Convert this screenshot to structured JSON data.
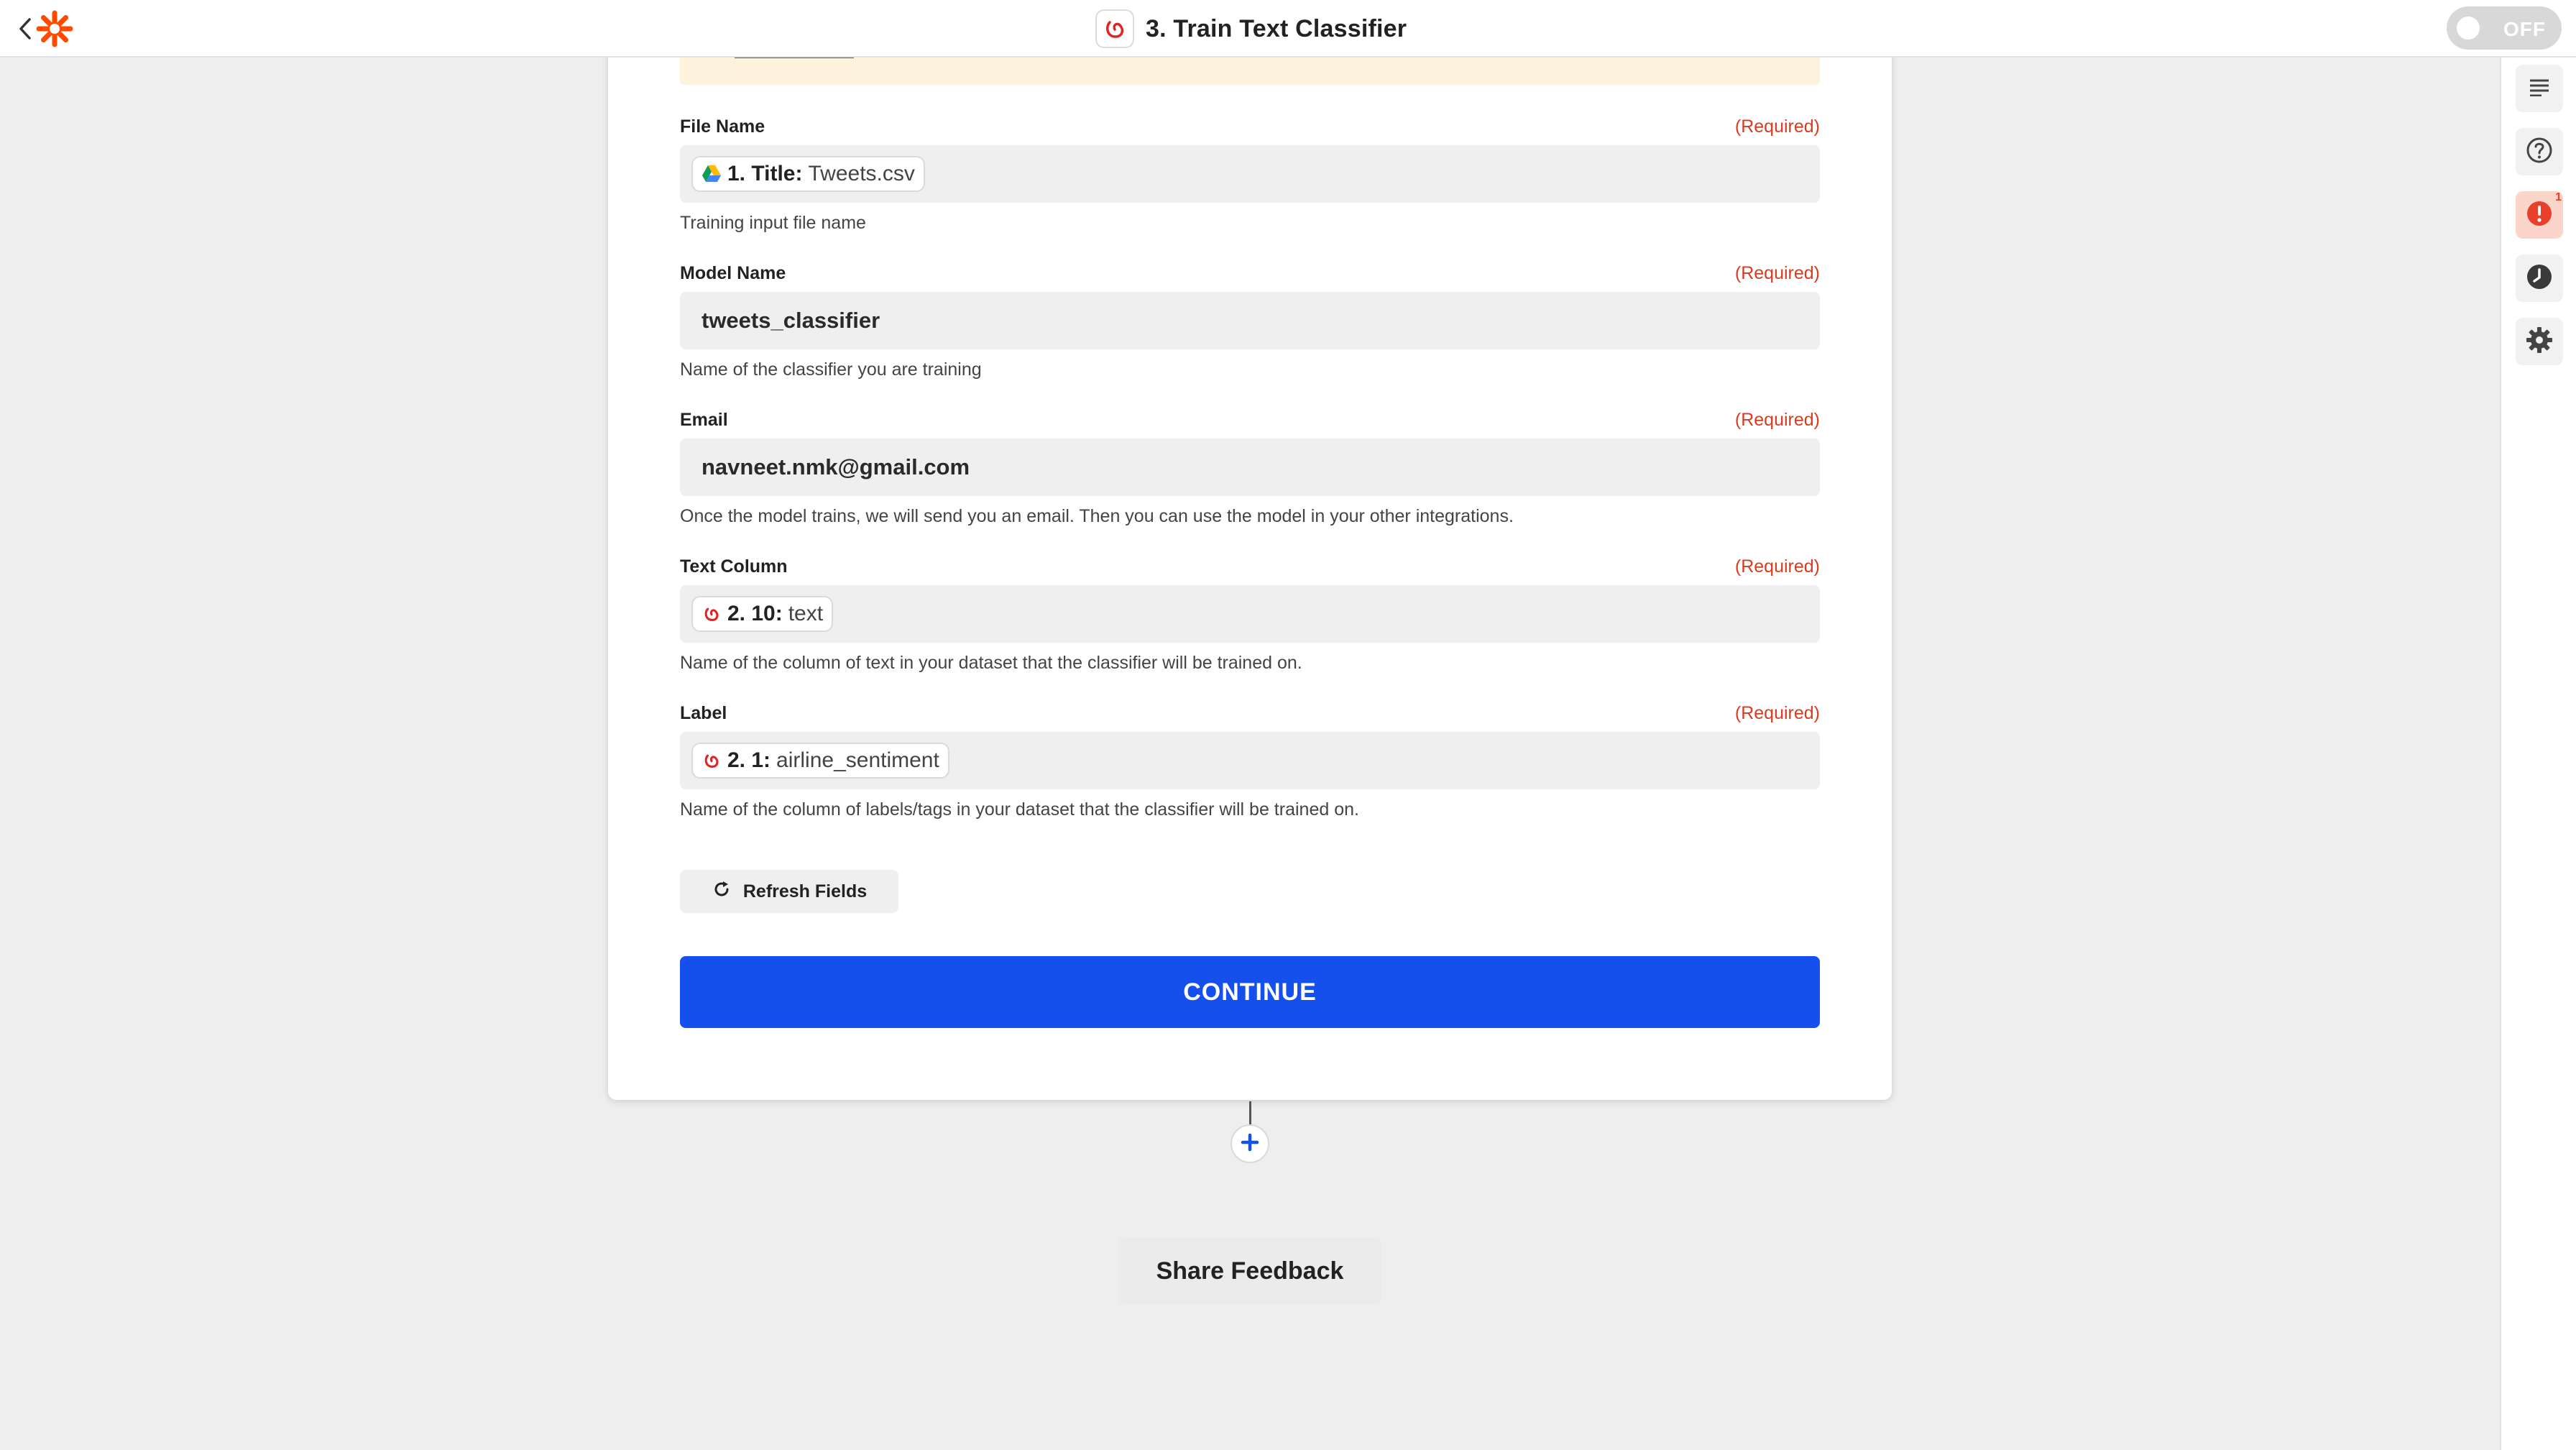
{
  "header": {
    "back_label": "Back",
    "title": "3. Train Text Classifier",
    "toggle_state": "OFF"
  },
  "form": {
    "fields": [
      {
        "label": "File Name",
        "required": "(Required)",
        "token": {
          "prefix": "1. Title:",
          "value": "Tweets.csv",
          "app_icon": "google-drive-icon"
        },
        "help": "Training input file name"
      },
      {
        "label": "Model Name",
        "required": "(Required)",
        "value": "tweets_classifier",
        "help": "Name of the classifier you are training"
      },
      {
        "label": "Email",
        "required": "(Required)",
        "value": "navneet.nmk@gmail.com",
        "help": "Once the model trains, we will send you an email. Then you can use the model in your other integrations."
      },
      {
        "label": "Text Column",
        "required": "(Required)",
        "token": {
          "prefix": "2. 10:",
          "value": "text",
          "app_icon": "nanonets-icon"
        },
        "help": "Name of the column of text in your dataset that the classifier will be trained on."
      },
      {
        "label": "Label",
        "required": "(Required)",
        "token": {
          "prefix": "2. 1:",
          "value": "airline_sentiment",
          "app_icon": "nanonets-icon"
        },
        "help": "Name of the column of labels/tags in your dataset that the classifier will be trained on."
      }
    ],
    "refresh_label": "Refresh Fields",
    "continue_label": "CONTINUE"
  },
  "footer": {
    "feedback_label": "Share Feedback"
  },
  "rail": {
    "alert_count": "1",
    "icons": [
      "details-icon",
      "help-icon",
      "alert-icon",
      "history-icon",
      "settings-icon"
    ]
  },
  "colors": {
    "primary": "#1650ec",
    "required": "#d83b1e",
    "brand": "#ff4a00",
    "warning_bg": "#fdf2dc",
    "alert": "#e8402a"
  }
}
